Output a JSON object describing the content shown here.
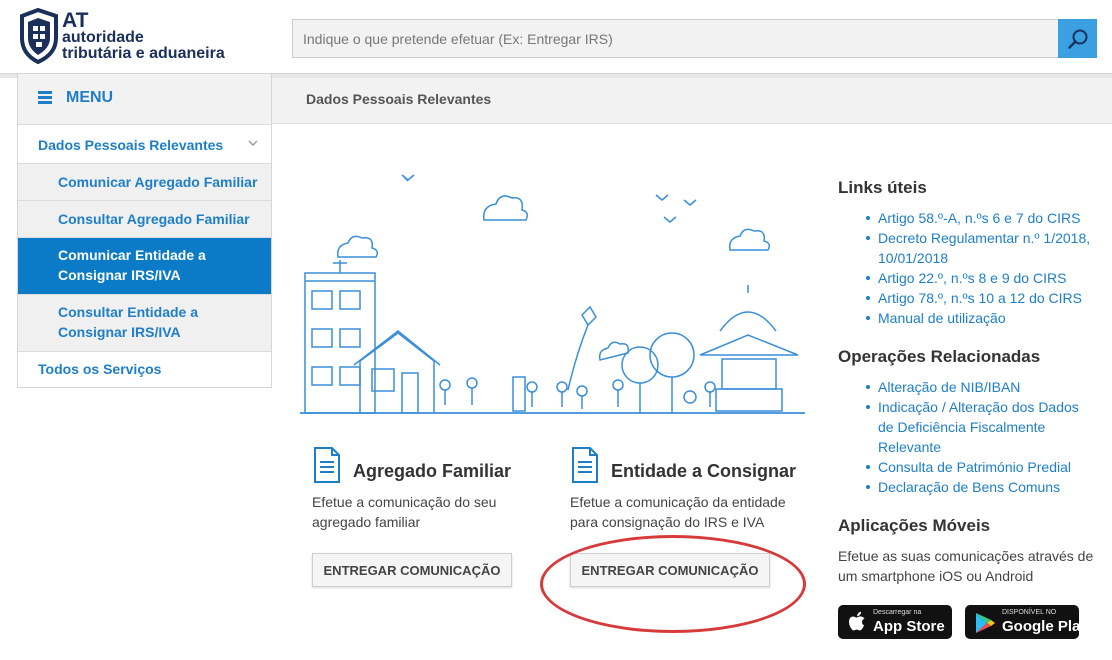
{
  "header": {
    "logo": {
      "line1": "AT",
      "line2": "autoridade",
      "line3": "tributária e aduaneira"
    },
    "search": {
      "placeholder": "Indique o que pretende efetuar (Ex: Entregar IRS)",
      "icon": "search-icon"
    }
  },
  "breadcrumb": {
    "current": "Dados Pessoais Relevantes"
  },
  "sidebar": {
    "menu_label": "MENU",
    "parent": "Dados Pessoais Relevantes",
    "items": [
      {
        "label": "Comunicar Agregado Familiar",
        "active": false
      },
      {
        "label": "Consultar Agregado Familiar",
        "active": false
      },
      {
        "label": "Comunicar Entidade a Consignar IRS/IVA",
        "active": true
      },
      {
        "label": "Consultar Entidade a Consignar IRS/IVA",
        "active": false
      }
    ],
    "footer": "Todos os Serviços"
  },
  "cards": [
    {
      "title": "Agregado Familiar",
      "desc": "Efetue a comunicação do seu agregado familiar",
      "button": "ENTREGAR COMUNICAÇÃO"
    },
    {
      "title": "Entidade a Consignar",
      "desc": "Efetue a comunicação da entidade para consignação do IRS e IVA",
      "button": "ENTREGAR COMUNICAÇÃO"
    }
  ],
  "right": {
    "links_title": "Links úteis",
    "links": [
      "Artigo 58.º-A, n.ºs 6 e 7 do CIRS",
      "Decreto Regulamentar n.º 1/2018, 10/01/2018",
      "Artigo 22.º, n.ºs 8 e 9 do CIRS",
      "Artigo 78.º, n.ºs 10 a 12 do CIRS",
      "Manual de utilização"
    ],
    "ops_title": "Operações Relacionadas",
    "ops": [
      "Alteração de NIB/IBAN",
      "Indicação / Alteração dos Dados de Deficiência Fiscalmente Relevante",
      "Consulta de Património Predial",
      "Declaração de Bens Comuns"
    ],
    "apps_title": "Aplicações Móveis",
    "apps_desc": "Efetue as suas comunicações através de um smartphone iOS ou Android",
    "app_store": {
      "small": "Descarregar na",
      "big": "App Store"
    },
    "google_play": {
      "small": "DISPONÍVEL NO",
      "big": "Google Play"
    }
  },
  "colors": {
    "accent": "#1e7fc8",
    "active_bg": "#0b7bc7",
    "annotation": "#d63a3a",
    "logo": "#1b2f5b"
  }
}
